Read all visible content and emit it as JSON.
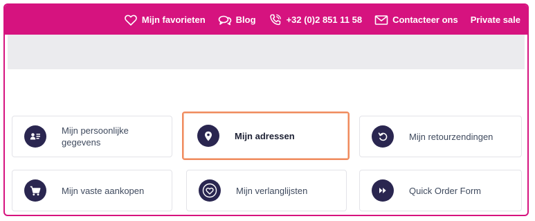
{
  "topbar": {
    "favorites": "Mijn favorieten",
    "blog": "Blog",
    "phone": "+32 (0)2 851 11 58",
    "contact": "Contacteer ons",
    "private_sale": "Private sale",
    "icons": [
      "heart-icon",
      "chat-bubbles-icon",
      "phone-icon",
      "envelope-icon"
    ]
  },
  "tiles": [
    {
      "label": "Mijn persoonlijke gegevens",
      "icon": "id-card-icon",
      "active": false
    },
    {
      "label": "Mijn adressen",
      "icon": "map-pin-icon",
      "active": true
    },
    {
      "label": "Mijn retourzendingen",
      "icon": "return-arrow-icon",
      "active": false
    },
    {
      "label": "Mijn vaste aankopen",
      "icon": "cart-icon",
      "active": false
    },
    {
      "label": "Mijn verlanglijsten",
      "icon": "heart-circle-icon",
      "active": false
    },
    {
      "label": "Quick Order Form",
      "icon": "fast-forward-icon",
      "active": false
    }
  ],
  "colors": {
    "brand": "#d6137f",
    "icon_circle": "#2a2650",
    "active_border": "#f08a5d",
    "grey_band": "#ebebee"
  }
}
